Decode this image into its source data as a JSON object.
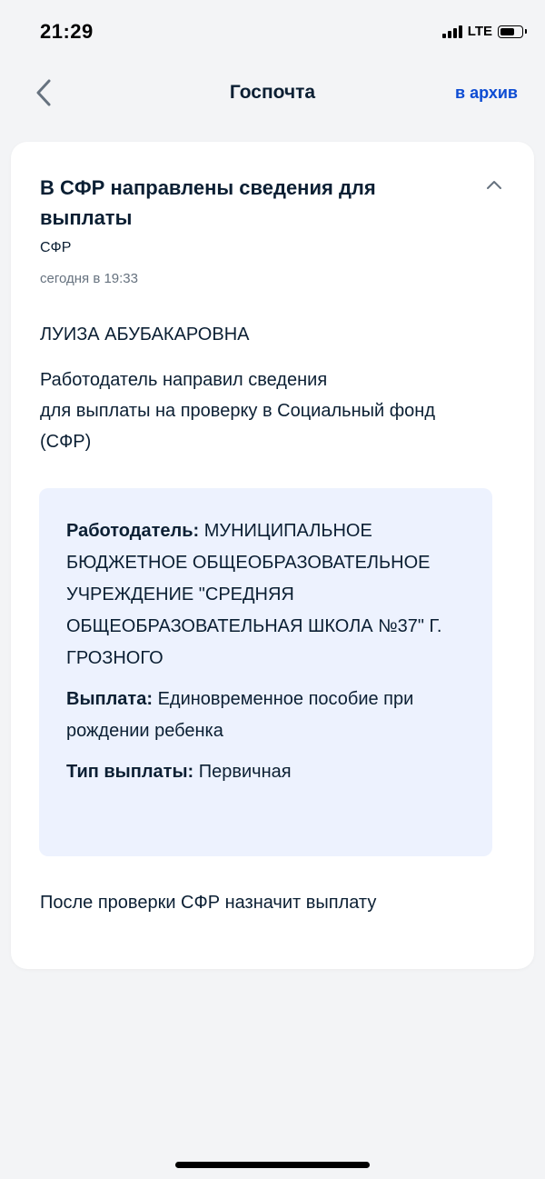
{
  "status_bar": {
    "time": "21:29",
    "network": "LTE",
    "signal_bars": 4,
    "battery_level": 0.7
  },
  "nav": {
    "back_icon": "chevron-left-icon",
    "title": "Госпочта",
    "archive_label": "в архив"
  },
  "colors": {
    "accent": "#0d4cd3",
    "text": "#0b1f33",
    "muted": "#66727f",
    "details_bg": "#edf2fe",
    "page_bg": "#f3f4f6"
  },
  "message": {
    "title": "В СФР направлены сведения для выплаты",
    "sender": "СФР",
    "date": "сегодня в 19:33",
    "collapse_icon": "chevron-up-icon",
    "recipient": "ЛУИЗА АБУБАКАРОВНА",
    "intro_line1": "Работодатель направил сведения",
    "intro_line2": "для выплаты на проверку в Социальный фонд (СФР)",
    "details": {
      "employer_label": "Работодатель:",
      "employer_value": "МУНИЦИПАЛЬНОЕ БЮДЖЕТНОЕ ОБЩЕОБРАЗОВАТЕЛЬНОЕ УЧРЕЖДЕНИЕ \"СРЕДНЯЯ ОБЩЕОБРАЗОВАТЕЛЬНАЯ ШКОЛА №37\" Г. ГРОЗНОГО",
      "payment_label": "Выплата:",
      "payment_value": "Единовременное пособие при рождении ребенка",
      "type_label": "Тип выплаты:",
      "type_value": "Первичная"
    },
    "footer": "После проверки СФР назначит выплату"
  }
}
